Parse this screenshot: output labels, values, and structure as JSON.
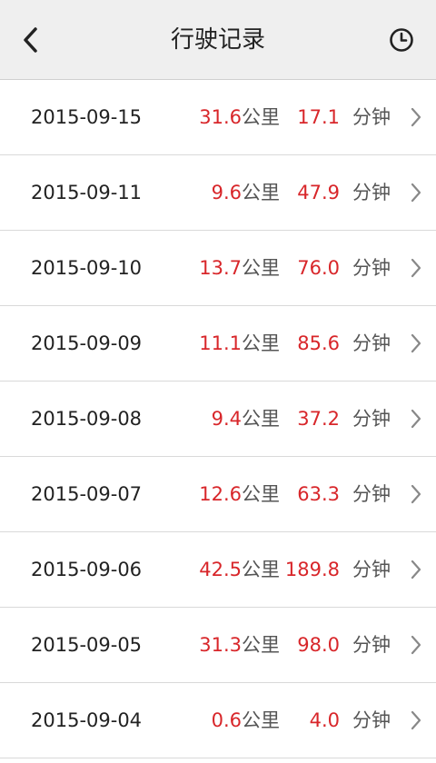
{
  "header": {
    "title": "行驶记录",
    "back_icon": "chevron-left-icon",
    "history_icon": "clock-icon"
  },
  "colors": {
    "accent_red": "#d8262a",
    "header_bg": "#efefef",
    "divider": "#d9d9d9"
  },
  "units": {
    "distance": "公里",
    "duration": "分钟"
  },
  "records": [
    {
      "date": "2015-09-15",
      "distance": "31.6",
      "duration": "17.1"
    },
    {
      "date": "2015-09-11",
      "distance": "9.6",
      "duration": "47.9"
    },
    {
      "date": "2015-09-10",
      "distance": "13.7",
      "duration": "76.0"
    },
    {
      "date": "2015-09-09",
      "distance": "11.1",
      "duration": "85.6"
    },
    {
      "date": "2015-09-08",
      "distance": "9.4",
      "duration": "37.2"
    },
    {
      "date": "2015-09-07",
      "distance": "12.6",
      "duration": "63.3"
    },
    {
      "date": "2015-09-06",
      "distance": "42.5",
      "duration": "189.8"
    },
    {
      "date": "2015-09-05",
      "distance": "31.3",
      "duration": "98.0"
    },
    {
      "date": "2015-09-04",
      "distance": "0.6",
      "duration": "4.0"
    }
  ]
}
